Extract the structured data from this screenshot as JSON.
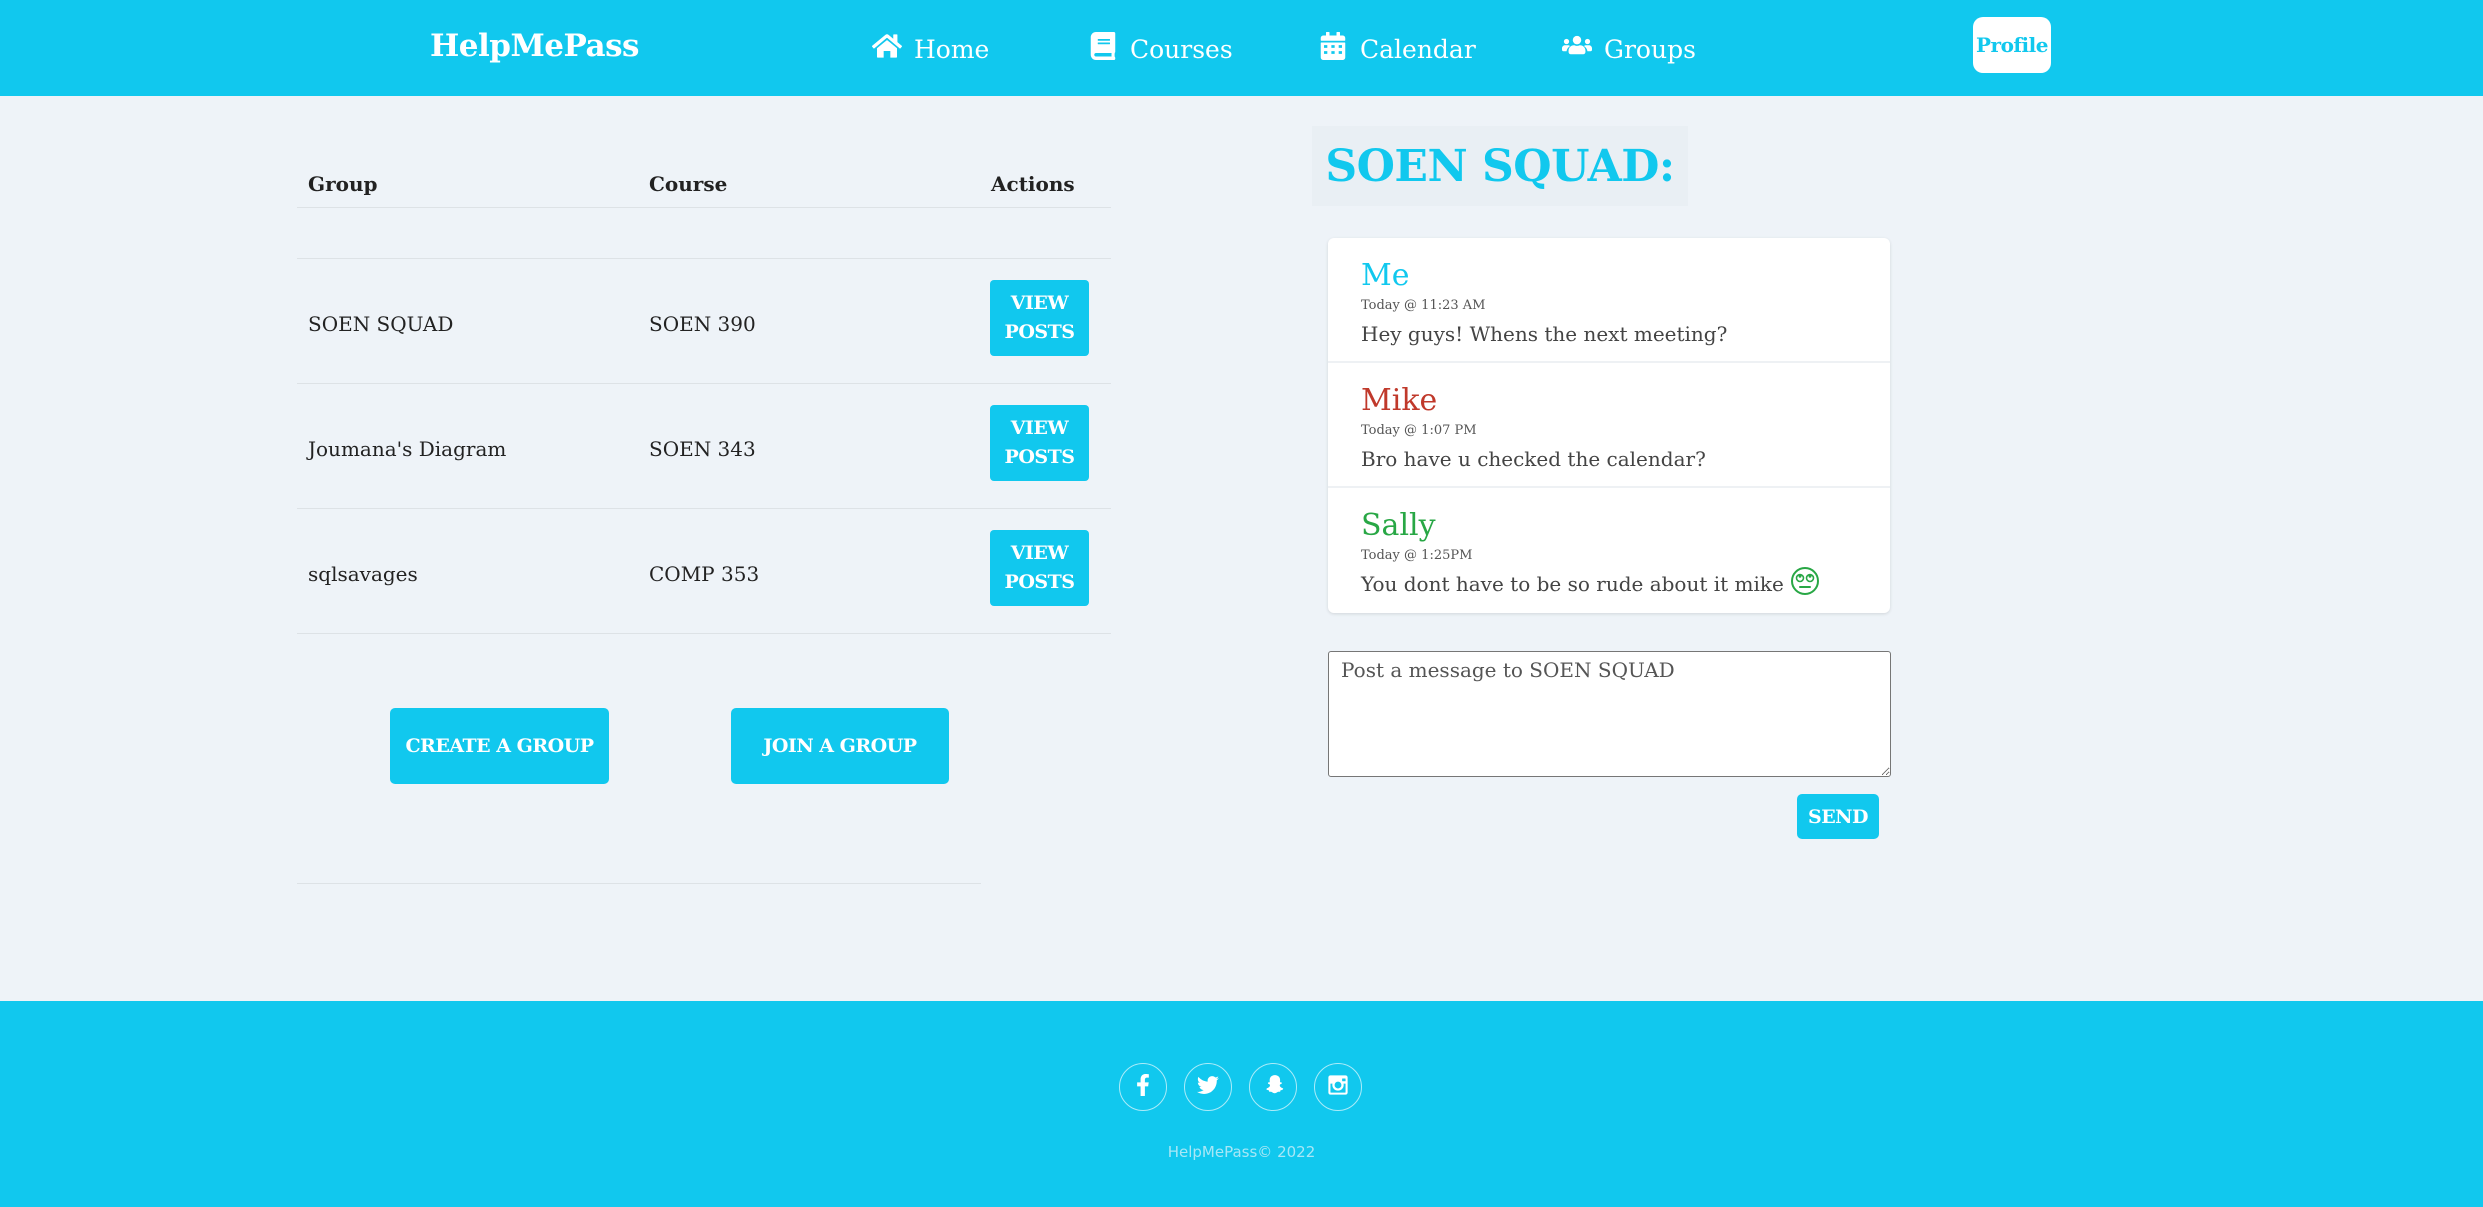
{
  "navbar": {
    "brand": "HelpMePass",
    "items": [
      {
        "label": "Home",
        "icon": "home-icon"
      },
      {
        "label": "Courses",
        "icon": "book-icon"
      },
      {
        "label": "Calendar",
        "icon": "calendar-icon"
      },
      {
        "label": "Groups",
        "icon": "users-icon"
      }
    ],
    "profile_label": "Profile"
  },
  "groups_table": {
    "headers": {
      "group": "Group",
      "course": "Course",
      "actions": "Actions"
    },
    "rows": [
      {
        "group": "SOEN SQUAD",
        "course": "SOEN 390",
        "action_label": "VIEW POSTS"
      },
      {
        "group": "Joumana's Diagram",
        "course": "SOEN 343",
        "action_label": "VIEW POSTS"
      },
      {
        "group": "sqlsavages",
        "course": "COMP 353",
        "action_label": "VIEW POSTS"
      }
    ]
  },
  "actions": {
    "create_label": "CREATE A GROUP",
    "join_label": "JOIN A GROUP"
  },
  "chat": {
    "title": "SOEN SQUAD:",
    "messages": [
      {
        "author": "Me",
        "time": "Today @ 11:23 AM",
        "text": "Hey guys! Whens the next meeting?",
        "color": "#11c8ee"
      },
      {
        "author": "Mike",
        "time": "Today @ 1:07 PM",
        "text": "Bro have u checked the calendar?",
        "color": "#c0392b"
      },
      {
        "author": "Sally",
        "time": "Today @ 1:25PM",
        "text": "You dont have to be so rude about it mike",
        "color": "#28a745",
        "emoji": "rolling-eyes-emoji"
      }
    ],
    "input_placeholder": "Post a message to SOEN SQUAD",
    "send_label": "SEND"
  },
  "footer": {
    "social": [
      "facebook-icon",
      "twitter-icon",
      "snapchat-icon",
      "instagram-icon"
    ],
    "copyright": "HelpMePass© 2022"
  },
  "colors": {
    "primary": "#11c8ee",
    "background": "#eef3f8",
    "mike": "#c0392b",
    "sally": "#28a745"
  }
}
